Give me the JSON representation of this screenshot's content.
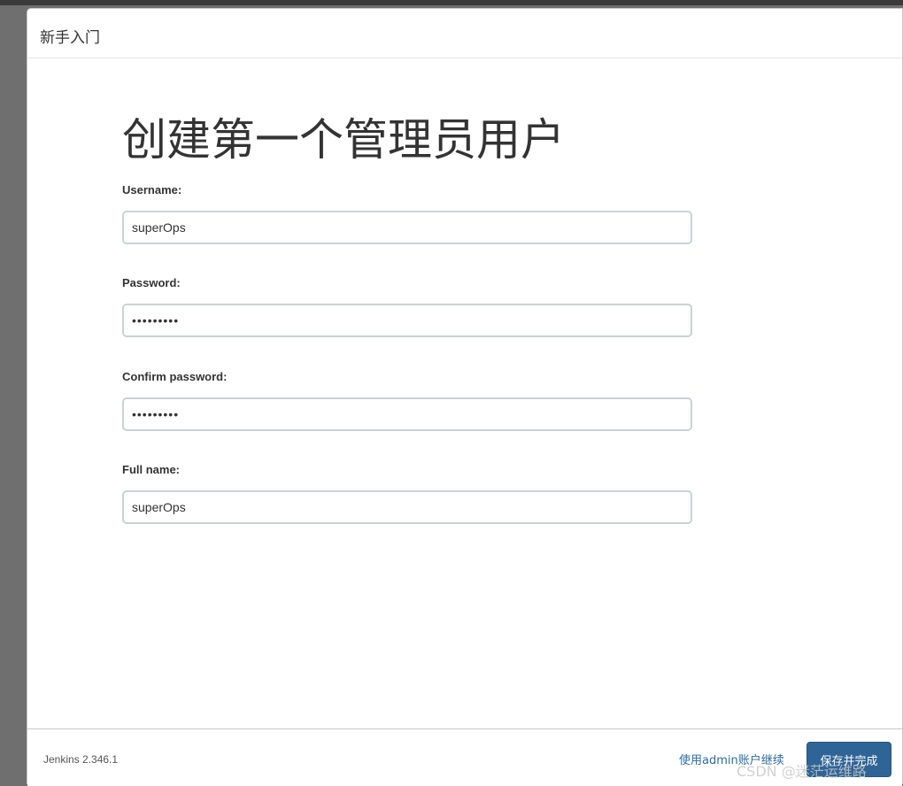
{
  "dialog": {
    "title": "新手入门"
  },
  "form": {
    "heading": "创建第一个管理员用户",
    "username": {
      "label": "Username:",
      "value": "superOps"
    },
    "password": {
      "label": "Password:",
      "value": "123456789"
    },
    "confirm_password": {
      "label": "Confirm password:",
      "value": "123456789"
    },
    "full_name": {
      "label": "Full name:",
      "value": "superOps"
    }
  },
  "footer": {
    "version": "Jenkins 2.346.1",
    "continue_link": "使用admin账户继续",
    "save_button": "保存并完成"
  },
  "watermark": "CSDN @迷茫运维路",
  "colors": {
    "primary_button": "#2f6496",
    "link": "#2b6ca8",
    "input_border": "#ccd1d6"
  }
}
